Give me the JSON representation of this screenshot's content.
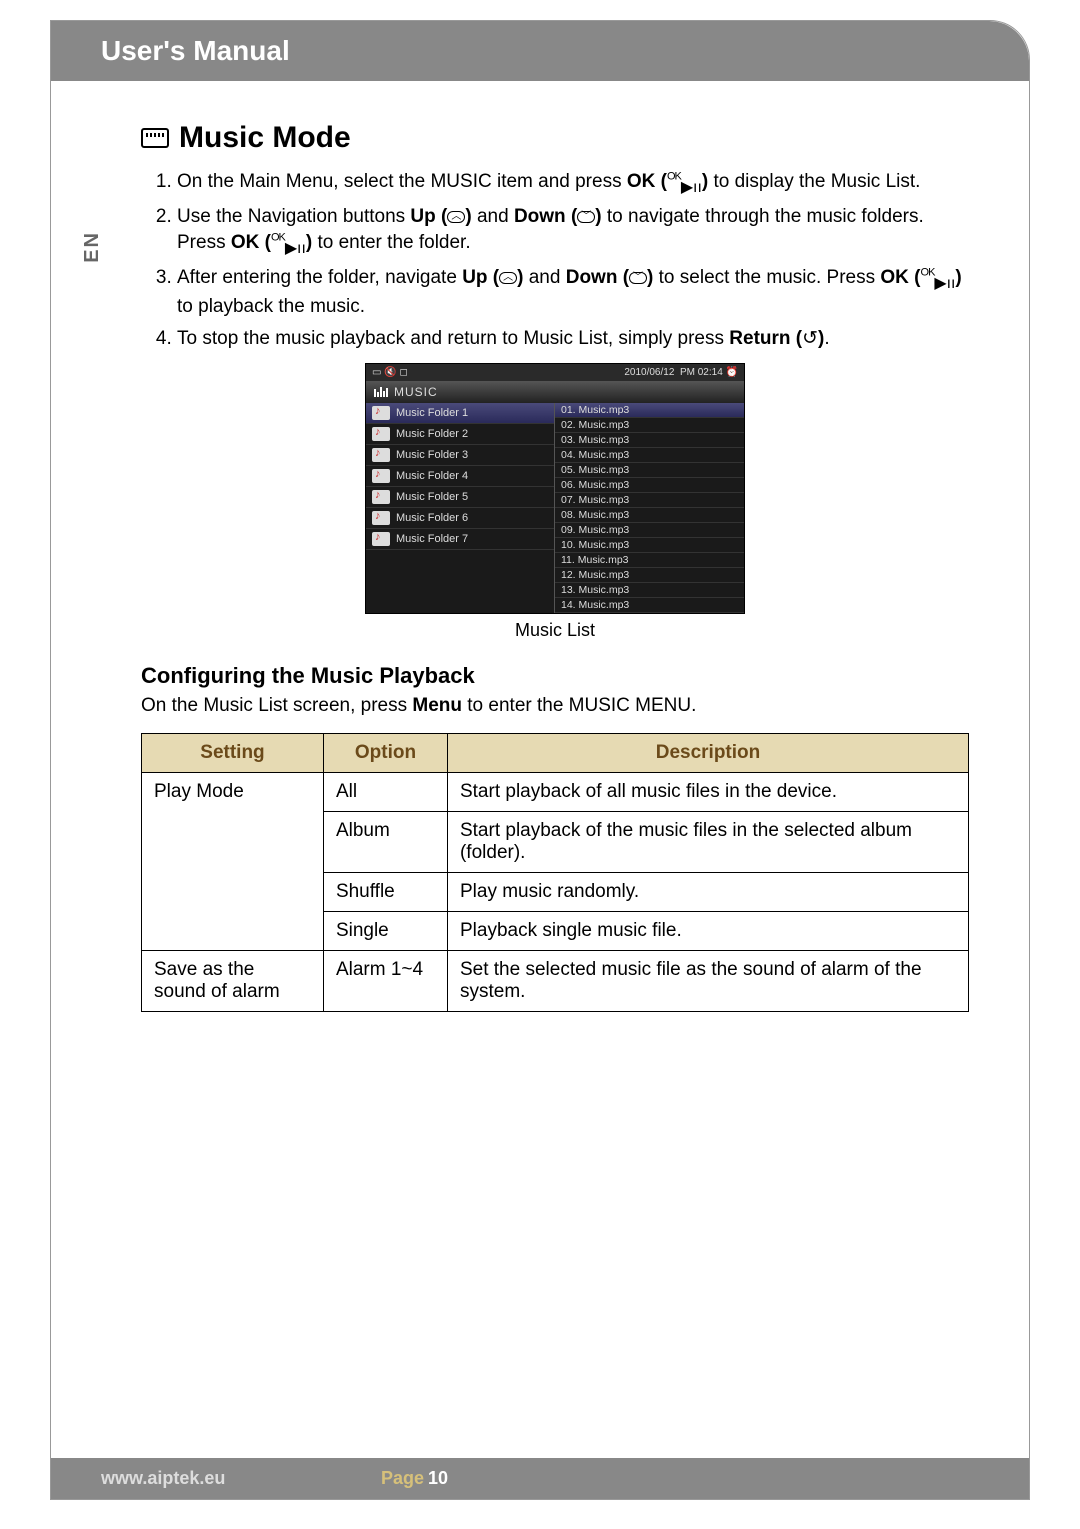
{
  "header": {
    "title": "User's Manual"
  },
  "lang_tab": "EN",
  "section": {
    "title": "Music Mode",
    "steps": [
      {
        "pre": "On the Main Menu, select the MUSIC item and press ",
        "b1": "OK (",
        "ok": "OK",
        "b2": ")",
        "post": " to display the Music List."
      },
      {
        "pre": "Use the Navigation buttons ",
        "up": "Up (",
        "upg": "︿",
        "up2": ")",
        "mid": " and ",
        "dn": "Down (",
        "dng": "﹀",
        "dn2": ")",
        "post": " to navigate through the music folders. Press ",
        "b1": "OK (",
        "ok": "OK",
        "b2": ")",
        "post2": " to enter the folder."
      },
      {
        "pre": "After entering the folder, navigate ",
        "up": "Up (",
        "upg": "︿",
        "up2": ")",
        "mid": " and ",
        "dn": "Down (",
        "dng": "﹀",
        "dn2": ")",
        "post": " to select the music. Press ",
        "b1": "OK (",
        "ok": "OK",
        "b2": ")",
        "post2": " to playback the music."
      },
      {
        "pre": "To stop the music playback and return to Music List, simply press ",
        "ret": "Return (",
        "retg": "↺",
        "ret2": ")",
        "post": "."
      }
    ]
  },
  "device": {
    "date": "2010/06/12",
    "time": "PM 02:14",
    "label": "MUSIC",
    "folders": [
      "Music Folder 1",
      "Music Folder 2",
      "Music Folder 3",
      "Music Folder 4",
      "Music Folder 5",
      "Music Folder 6",
      "Music Folder 7"
    ],
    "files": [
      "01. Music.mp3",
      "02. Music.mp3",
      "03. Music.mp3",
      "04. Music.mp3",
      "05. Music.mp3",
      "06. Music.mp3",
      "07. Music.mp3",
      "08. Music.mp3",
      "09. Music.mp3",
      "10. Music.mp3",
      "11. Music.mp3",
      "12. Music.mp3",
      "13. Music.mp3",
      "14. Music.mp3"
    ],
    "caption": "Music List"
  },
  "config": {
    "heading": "Configuring the Music Playback",
    "lead_pre": "On the Music List screen, press ",
    "lead_b": "Menu",
    "lead_post": " to enter the MUSIC MENU.",
    "headers": {
      "setting": "Setting",
      "option": "Option",
      "description": "Description"
    },
    "rows": [
      {
        "setting": "Play Mode",
        "option": "All",
        "desc": "Start playback of all music files in the device."
      },
      {
        "setting": "",
        "option": "Album",
        "desc": "Start playback of the music files in the selected album (folder)."
      },
      {
        "setting": "",
        "option": "Shuffle",
        "desc": "Play music randomly."
      },
      {
        "setting": "",
        "option": "Single",
        "desc": "Playback single music file."
      },
      {
        "setting": "Save as the sound of alarm",
        "option": "Alarm 1~4",
        "desc": "Set the selected music file as the sound of alarm of the system."
      }
    ]
  },
  "footer": {
    "url": "www.aiptek.eu",
    "page_label": "Page",
    "page_num": "10"
  }
}
